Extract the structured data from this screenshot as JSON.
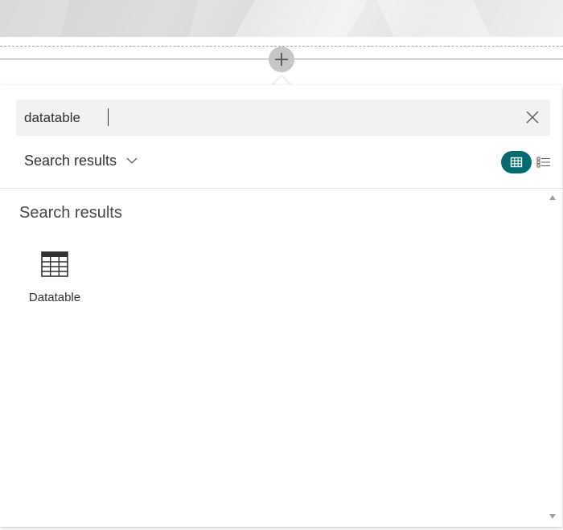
{
  "search": {
    "value": "datatable",
    "clear_icon": "close-icon"
  },
  "toolbar": {
    "add_icon": "plus-icon",
    "scope_label": "Search results",
    "scope_icon": "chevron-down-icon",
    "grid_view_icon": "grid-view-icon",
    "list_view_icon": "list-view-icon"
  },
  "results": {
    "heading": "Search results",
    "items": [
      {
        "label": "Datatable",
        "icon": "table-icon"
      }
    ]
  },
  "colors": {
    "accent": "#036c70",
    "search_bg": "#f3f2f1",
    "text": "#323130"
  }
}
